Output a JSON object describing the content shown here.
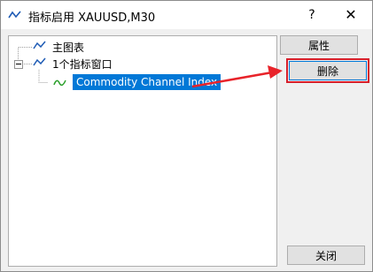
{
  "window": {
    "title": "指标启用 XAUUSD,M30",
    "help": "?",
    "close": "✕"
  },
  "tree": {
    "root_label": "主图表",
    "group_label": "1个指标窗口",
    "selected_label": "Commodity Channel Index"
  },
  "buttons": {
    "properties": "属性",
    "delete": "删除",
    "close": "关闭"
  },
  "colors": {
    "accent": "#0078d7",
    "highlight": "#d61f2b",
    "chart_line": "#1e5bb5",
    "cci_line": "#2ca02c"
  }
}
